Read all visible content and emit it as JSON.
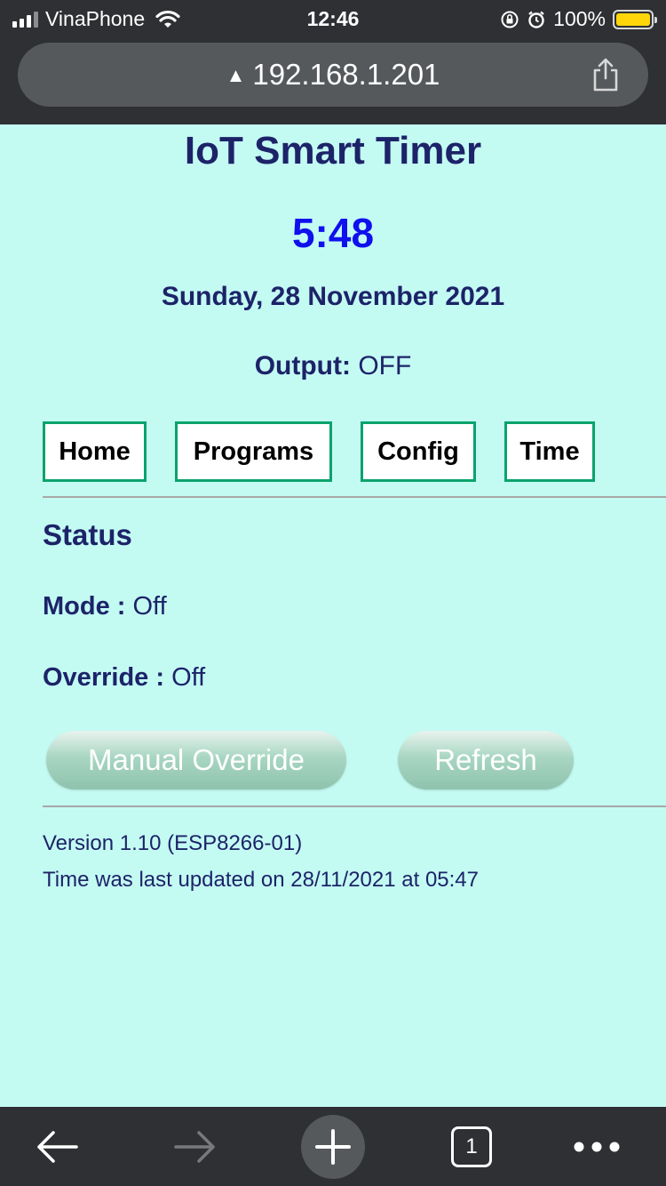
{
  "status_bar": {
    "carrier": "VinaPhone",
    "time": "12:46",
    "battery_percent": "100%"
  },
  "address_bar": {
    "url": "192.168.1.201"
  },
  "page": {
    "title": "IoT Smart Timer",
    "clock": "5:48",
    "date": "Sunday, 28 November 2021",
    "output_label": "Output:",
    "output_value": "OFF"
  },
  "nav": {
    "items": [
      {
        "label": "Home"
      },
      {
        "label": "Programs"
      },
      {
        "label": "Config"
      },
      {
        "label": "Time"
      }
    ]
  },
  "status": {
    "heading": "Status",
    "mode_label": "Mode :",
    "mode_value": "Off",
    "override_label": "Override :",
    "override_value": "Off"
  },
  "actions": {
    "manual_override": "Manual Override",
    "refresh": "Refresh"
  },
  "footer": {
    "version": "Version 1.10 (ESP8266-01)",
    "last_updated": "Time was last updated on 28/11/2021 at 05:47"
  },
  "toolbar": {
    "tab_count": "1"
  },
  "colors": {
    "page_bg": "#c3fbf3",
    "text": "#1d2368",
    "clock": "#1010ee",
    "nav_border": "#0aa36c",
    "chrome": "#2e3033"
  }
}
